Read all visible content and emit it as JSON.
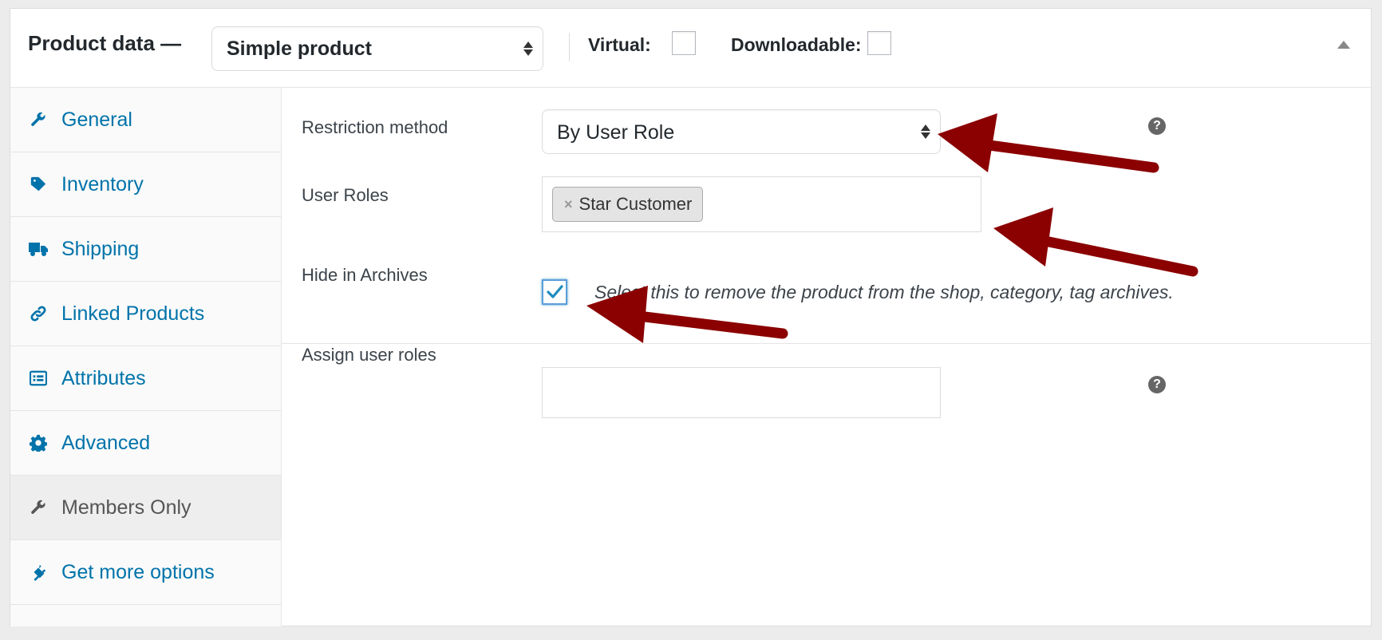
{
  "header": {
    "title": "Product data —",
    "product_type": "Simple product",
    "virtual_label": "Virtual:",
    "virtual_checked": false,
    "downloadable_label": "Downloadable:",
    "downloadable_checked": false
  },
  "sidebar": {
    "active_tab": "Members Only",
    "items": [
      {
        "label": "General",
        "icon": "wrench-icon"
      },
      {
        "label": "Inventory",
        "icon": "tag-icon"
      },
      {
        "label": "Shipping",
        "icon": "truck-icon"
      },
      {
        "label": "Linked Products",
        "icon": "link-icon"
      },
      {
        "label": "Attributes",
        "icon": "list-icon"
      },
      {
        "label": "Advanced",
        "icon": "gear-icon"
      },
      {
        "label": "Members Only",
        "icon": "wrench-icon"
      },
      {
        "label": "Get more options",
        "icon": "plugin-icon"
      }
    ]
  },
  "main": {
    "restriction_method": {
      "label": "Restriction method",
      "value": "By User Role"
    },
    "user_roles": {
      "label": "User Roles",
      "tokens": [
        "Star Customer"
      ],
      "remove_glyph": "×"
    },
    "hide_in_archives": {
      "label": "Hide in Archives",
      "checked": true,
      "description": "Select this to remove the product from the shop, category, tag archives."
    },
    "assign_user_roles": {
      "label": "Assign user roles",
      "value": ""
    },
    "help_glyph": "?"
  },
  "colors": {
    "link": "#0073aa",
    "annotation_arrow": "#8b0000",
    "checkbox_focus": "#5b9dd9"
  }
}
